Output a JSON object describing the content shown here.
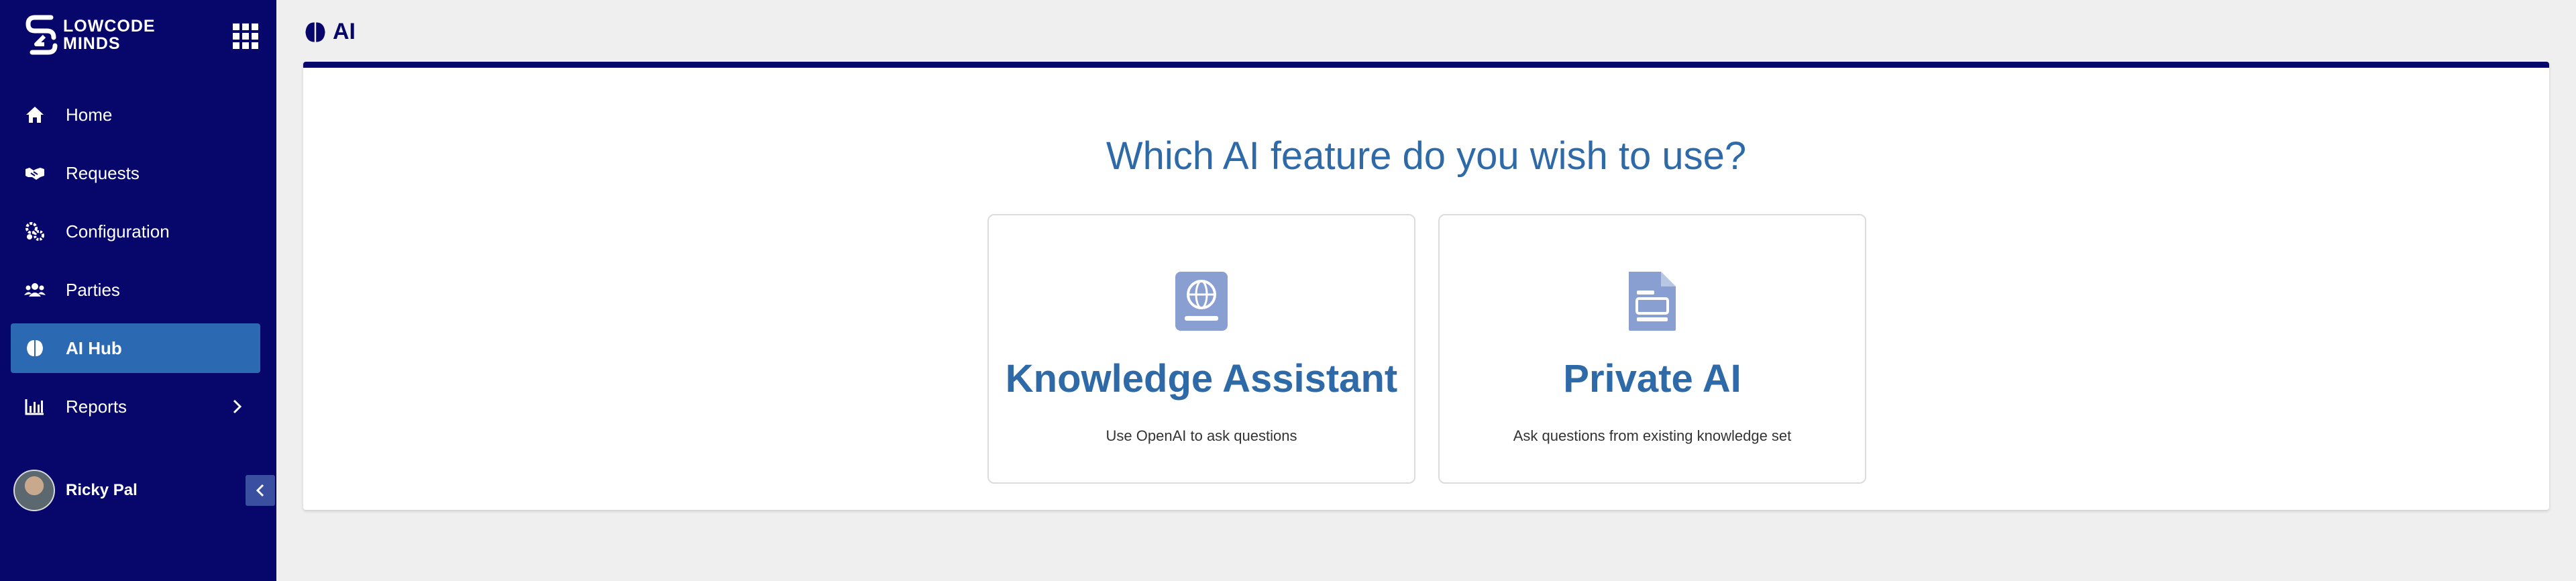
{
  "brand": {
    "line1": "LOWCODE",
    "line2": "MINDS"
  },
  "sidebar": {
    "items": [
      {
        "label": "Home",
        "icon": "home-icon"
      },
      {
        "label": "Requests",
        "icon": "handshake-icon"
      },
      {
        "label": "Configuration",
        "icon": "cogs-icon"
      },
      {
        "label": "Parties",
        "icon": "users-icon"
      },
      {
        "label": "AI Hub",
        "icon": "brain-icon",
        "active": true
      },
      {
        "label": "Reports",
        "icon": "chart-icon",
        "has_submenu": true
      }
    ],
    "user": {
      "name": "Ricky Pal"
    }
  },
  "header": {
    "title": "AI"
  },
  "main": {
    "question": "Which AI feature do you wish to use?",
    "options": [
      {
        "title": "Knowledge Assistant",
        "description": "Use OpenAI to ask questions",
        "icon": "book-globe-icon"
      },
      {
        "title": "Private AI",
        "description": "Ask questions from existing knowledge set",
        "icon": "document-icon"
      }
    ]
  },
  "colors": {
    "sidebar_bg": "#07076b",
    "accent": "#2f6aa8",
    "active_item": "#2b6ab3",
    "icon_tint": "#8a9fd1"
  }
}
